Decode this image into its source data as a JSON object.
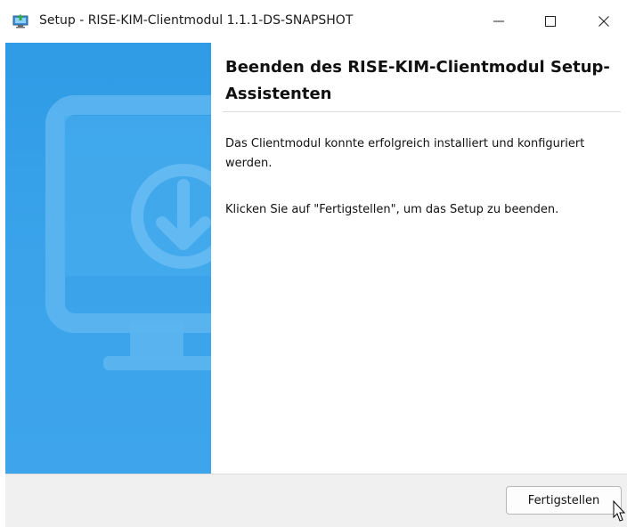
{
  "window": {
    "title": "Setup - RISE-KIM-Clientmodul 1.1.1-DS-SNAPSHOT",
    "app_icon": "installer-icon",
    "minimize_icon": "minimize-icon",
    "maximize_icon": "maximize-icon",
    "close_icon": "close-icon"
  },
  "banner": {
    "icon": "monitor-download-icon",
    "color": "#3aa3ea"
  },
  "content": {
    "heading": "Beenden des RISE-KIM-Clientmodul Setup-Assistenten",
    "paragraph1": "Das Clientmodul konnte erfolgreich installiert und konfiguriert werden.",
    "paragraph2": "Klicken Sie auf \"Fertigstellen\", um das Setup zu beenden."
  },
  "footer": {
    "finish_label": "Fertigstellen"
  }
}
